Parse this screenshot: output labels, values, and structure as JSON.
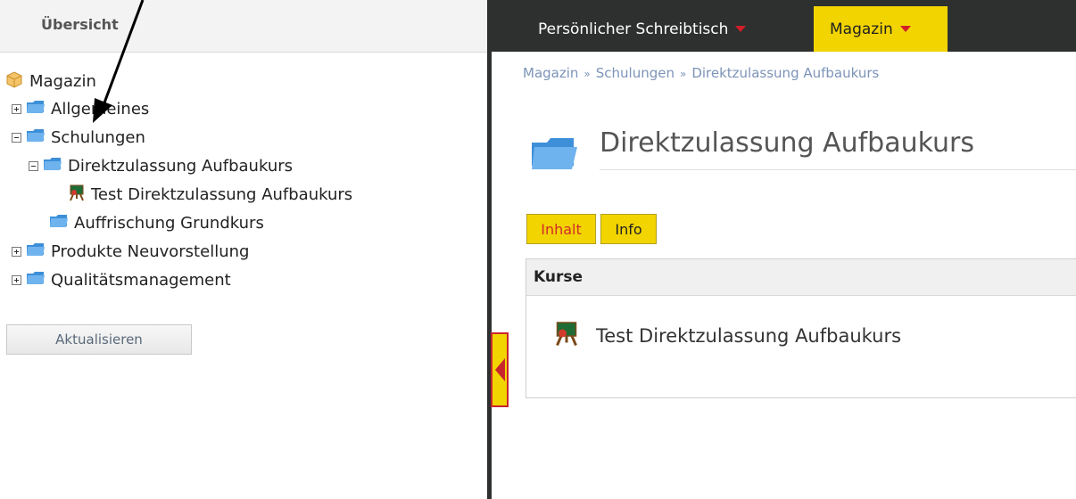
{
  "sidebar": {
    "title": "Übersicht",
    "tree": [
      {
        "label": "Magazin",
        "icon": "box-icon"
      },
      {
        "label": "Allgemeines",
        "icon": "folder-icon",
        "toggle": "expand"
      },
      {
        "label": "Schulungen",
        "icon": "folder-icon",
        "toggle": "collapse"
      },
      {
        "label": "Direktzulassung Aufbaukurs",
        "icon": "folder-icon",
        "toggle": "collapse"
      },
      {
        "label": "Test Direktzulassung Aufbaukurs",
        "icon": "course-board-icon"
      },
      {
        "label": "Auffrischung Grundkurs",
        "icon": "folder-icon"
      },
      {
        "label": "Produkte Neuvorstellung",
        "icon": "folder-icon",
        "toggle": "expand"
      },
      {
        "label": "Qualitätsmanagement",
        "icon": "folder-icon",
        "toggle": "expand"
      }
    ],
    "refresh_label": "Aktualisieren"
  },
  "topnav": {
    "desk_label": "Persönlicher Schreibtisch",
    "magazine_label": "Magazin"
  },
  "breadcrumb": [
    "Magazin",
    "Schulungen",
    "Direktzulassung Aufbaukurs"
  ],
  "breadcrumb_separator": "»",
  "page": {
    "title": "Direktzulassung Aufbaukurs",
    "tabs": [
      {
        "label": "Inhalt",
        "active": true
      },
      {
        "label": "Info",
        "active": false
      }
    ],
    "section_title": "Kurse",
    "items": [
      {
        "label": "Test Direktzulassung Aufbaukurs",
        "icon": "course-board-icon"
      }
    ]
  },
  "colors": {
    "topbar_bg": "#2e3030",
    "accent_yellow": "#f2d400",
    "accent_red": "#d21e28",
    "breadcrumb_link": "#7c93b8"
  }
}
